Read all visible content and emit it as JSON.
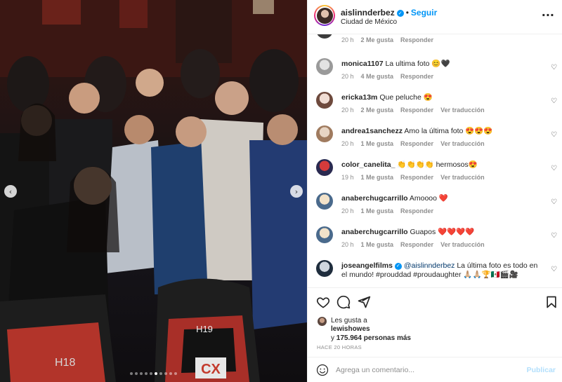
{
  "post": {
    "username": "aislinnderbez",
    "verified": true,
    "follow_label": "Seguir",
    "location": "Ciudad de México",
    "more_icon": "more-horizontal-icon"
  },
  "photo": {
    "seat_label": "H19",
    "seat_label_left": "H18",
    "brand": "CX",
    "carousel_count": 10,
    "carousel_active_index": 5
  },
  "comments": [
    {
      "username": "",
      "text": "",
      "time": "20 h",
      "likes": "2 Me gusta",
      "reply": "Responder",
      "translate": "",
      "avatar_colors": [
        "#d9d9d9",
        "#3b3b3b"
      ]
    },
    {
      "username": "monica1107",
      "text": "La ultima foto 😊🖤",
      "time": "20 h",
      "likes": "4 Me gusta",
      "reply": "Responder",
      "translate": "",
      "avatar_colors": [
        "#e3e3e3",
        "#9a9a9a"
      ]
    },
    {
      "username": "ericka13m",
      "text": "Que peluche 😍",
      "time": "20 h",
      "likes": "2 Me gusta",
      "reply": "Responder",
      "translate": "Ver traducción",
      "avatar_colors": [
        "#f0ddd4",
        "#6e4a3d"
      ]
    },
    {
      "username": "andrea1sanchezz",
      "text": "Amo la última foto 😍😍😍",
      "time": "20 h",
      "likes": "1 Me gusta",
      "reply": "Responder",
      "translate": "Ver traducción",
      "avatar_colors": [
        "#e7d5c4",
        "#a07b5f"
      ]
    },
    {
      "username": "color_canelita_",
      "text": "👏👏👏👏 hermosos😍",
      "time": "19 h",
      "likes": "1 Me gusta",
      "reply": "Responder",
      "translate": "Ver traducción",
      "avatar_colors": [
        "#d63b3b",
        "#2a2a50"
      ]
    },
    {
      "username": "anaberchugcarrillo",
      "text": "Amoooo ❤️",
      "time": "20 h",
      "likes": "1 Me gusta",
      "reply": "Responder",
      "translate": "",
      "avatar_colors": [
        "#f2e2c9",
        "#4a6a8c"
      ]
    },
    {
      "username": "anaberchugcarrillo",
      "text": "Guapos ❤️❤️❤️❤️",
      "time": "20 h",
      "likes": "1 Me gusta",
      "reply": "Responder",
      "translate": "Ver traducción",
      "avatar_colors": [
        "#f2e2c9",
        "#4a6a8c"
      ]
    },
    {
      "username": "joseangelfilms",
      "verified": true,
      "mention": "@aislinnderbez",
      "text": " La última foto es todo en el mundo! #prouddad #proudaughter 🙏🏼🙏🏼🏆🇲🇽🎬🎥",
      "time": "",
      "likes": "",
      "reply": "",
      "translate": "",
      "avatar_colors": [
        "#cfd6de",
        "#1f2d3d"
      ]
    }
  ],
  "likes": {
    "prefix": "Les gusta a",
    "first_user": "lewishowes",
    "and_label": "y",
    "others": "175.964 personas más"
  },
  "time_ago": "HACE 20 HORAS",
  "compose": {
    "placeholder": "Agrega un comentario...",
    "publish_label": "Publicar"
  },
  "icons": {
    "like": "heart-icon",
    "comment": "comment-icon",
    "share": "share-icon",
    "save": "bookmark-icon",
    "emoji": "emoji-icon"
  }
}
